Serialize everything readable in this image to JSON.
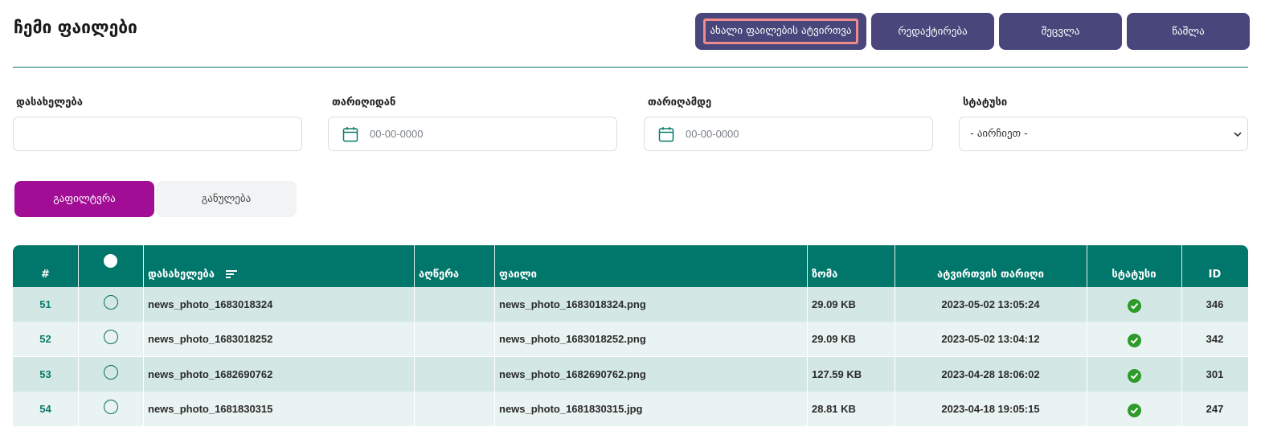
{
  "page": {
    "title": "ჩემი ფაილები"
  },
  "toolbar": {
    "upload_label": "ახალი ფაილების ატვირთვა",
    "edit_label": "რედაქტირება",
    "change_label": "შეცვლა",
    "delete_label": "წაშლა"
  },
  "filters": {
    "name_label": "დასახელება",
    "name_value": "",
    "date_from_label": "თარიღიდან",
    "date_from_placeholder": "00-00-0000",
    "date_to_label": "თარიღამდე",
    "date_to_placeholder": "00-00-0000",
    "status_label": "სტატუსი",
    "status_selected": "- აირჩიეთ -",
    "filter_button": "გაფილტვრა",
    "reset_button": "განულება"
  },
  "table": {
    "headers": {
      "num": "#",
      "name": "დასახელება",
      "description": "აღწერა",
      "file": "ფაილი",
      "size": "ზომა",
      "upload_date": "ატვირთვის თარიღი",
      "status": "სტატუსი",
      "id": "ID"
    },
    "rows": [
      {
        "num": "51",
        "name": "news_photo_1683018324",
        "description": "",
        "file": "news_photo_1683018324.png",
        "size": "29.09 KB",
        "upload_date": "2023-05-02 13:05:24",
        "id": "346"
      },
      {
        "num": "52",
        "name": "news_photo_1683018252",
        "description": "",
        "file": "news_photo_1683018252.png",
        "size": "29.09 KB",
        "upload_date": "2023-05-02 13:04:12",
        "id": "342"
      },
      {
        "num": "53",
        "name": "news_photo_1682690762",
        "description": "",
        "file": "news_photo_1682690762.png",
        "size": "127.59 KB",
        "upload_date": "2023-04-28 18:06:02",
        "id": "301"
      },
      {
        "num": "54",
        "name": "news_photo_1681830315",
        "description": "",
        "file": "news_photo_1681830315.jpg",
        "size": "28.81 KB",
        "upload_date": "2023-04-18 19:05:15",
        "id": "247"
      }
    ]
  },
  "colors": {
    "toolbar_button": "#48467a",
    "highlight_outline": "#f08a8c",
    "accent_teal": "#00776a",
    "filter_button": "#a10d95",
    "status_ok": "#2d9a2a"
  },
  "icons": [
    "calendar-icon",
    "chevron-down-icon",
    "sort-icon",
    "check-circle-icon"
  ]
}
